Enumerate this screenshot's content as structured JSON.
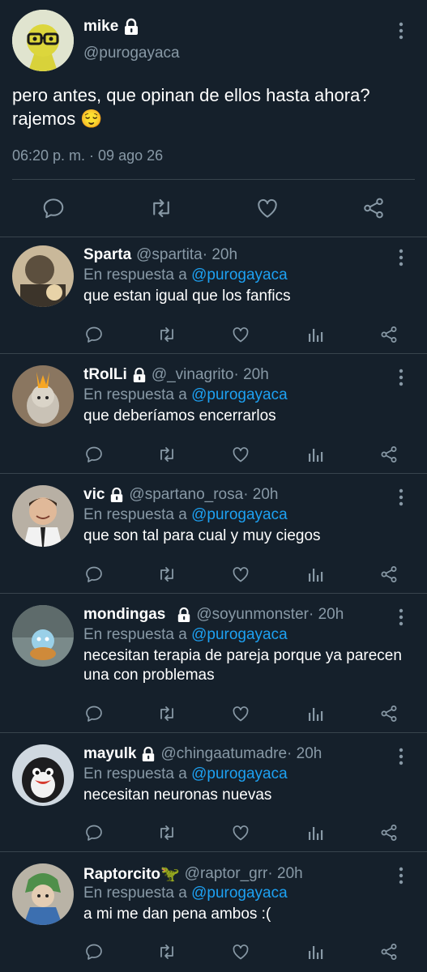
{
  "colors": {
    "background": "#15202b",
    "text": "#ffffff",
    "muted": "#8899a6",
    "link": "#1da1f2",
    "divider": "#38444d"
  },
  "tweet": {
    "author_name": "mike",
    "author_handle": "@purogayaca",
    "text": "pero antes, que opinan de ellos hasta ahora? rajemos 😌",
    "timestamp": "06:20 p. m. · 09 ago 26",
    "actions": [
      "comment-icon",
      "retweet-icon",
      "heart-icon",
      "share-icon"
    ]
  },
  "reply_prefix": "En respuesta a",
  "replies": [
    {
      "name": "Sparta",
      "locked": false,
      "handle": "@spartita",
      "time": " · 20h",
      "reply_to": "@purogayaca",
      "text": "que estan igual que los fanfics"
    },
    {
      "name": "tRolLi",
      "locked": true,
      "handle": "@_vinagrito",
      "time": " · 20h",
      "reply_to": "@purogayaca",
      "text": "que deberíamos encerrarlos"
    },
    {
      "name": "vic",
      "locked": true,
      "handle": "@spartano_rosa",
      "time": " · 20h",
      "reply_to": "@purogayaca",
      "text": "que son tal para cual y muy ciegos"
    },
    {
      "name": "mondingas",
      "locked": true,
      "handle": "@soyunmonster",
      "time": " · 20h",
      "reply_to": "@purogayaca",
      "text": "necesitan terapia de pareja porque ya parecen una con problemas"
    },
    {
      "name": "mayulk",
      "locked": true,
      "handle": "@chingaatumadre",
      "time": " · 20h",
      "reply_to": "@purogayaca",
      "text": "necesitan neuronas nuevas"
    },
    {
      "name": "Raptorcito🦖",
      "locked": false,
      "handle": "@raptor_grr",
      "time": " · 20h",
      "reply_to": "@purogayaca",
      "text": "a mi me dan pena ambos :("
    }
  ]
}
